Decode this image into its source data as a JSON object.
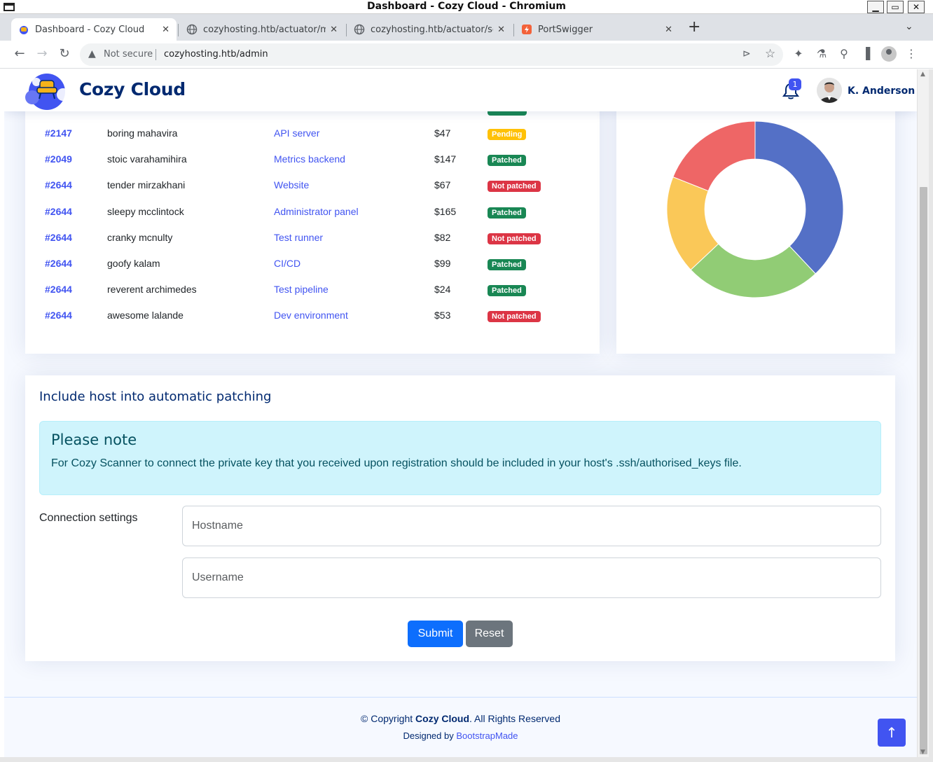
{
  "window": {
    "title": "Dashboard - Cozy Cloud - Chromium"
  },
  "tabs": [
    {
      "label": "Dashboard - Cozy Cloud",
      "active": true
    },
    {
      "label": "cozyhosting.htb/actuator/m",
      "active": false
    },
    {
      "label": "cozyhosting.htb/actuator/se",
      "active": false
    },
    {
      "label": "PortSwigger",
      "active": false
    }
  ],
  "address_bar": {
    "security_label": "Not secure",
    "url": "cozyhosting.htb/admin"
  },
  "header": {
    "brand": "Cozy Cloud",
    "notification_count": "1",
    "user_name": "K. Anderson"
  },
  "table": {
    "rows": [
      {
        "id": "#2147",
        "name": "boring mahavira",
        "service": "API server",
        "price": "$47",
        "status": "Pending",
        "status_type": "pending"
      },
      {
        "id": "#2049",
        "name": "stoic varahamihira",
        "service": "Metrics backend",
        "price": "$147",
        "status": "Patched",
        "status_type": "patched"
      },
      {
        "id": "#2644",
        "name": "tender mirzakhani",
        "service": "Website",
        "price": "$67",
        "status": "Not patched",
        "status_type": "notpatched"
      },
      {
        "id": "#2644",
        "name": "sleepy mcclintock",
        "service": "Administrator panel",
        "price": "$165",
        "status": "Patched",
        "status_type": "patched"
      },
      {
        "id": "#2644",
        "name": "cranky mcnulty",
        "service": "Test runner",
        "price": "$82",
        "status": "Not patched",
        "status_type": "notpatched"
      },
      {
        "id": "#2644",
        "name": "goofy kalam",
        "service": "CI/CD",
        "price": "$99",
        "status": "Patched",
        "status_type": "patched"
      },
      {
        "id": "#2644",
        "name": "reverent archimedes",
        "service": "Test pipeline",
        "price": "$24",
        "status": "Patched",
        "status_type": "patched"
      },
      {
        "id": "#2644",
        "name": "awesome lalande",
        "service": "Dev environment",
        "price": "$53",
        "status": "Not patched",
        "status_type": "notpatched"
      }
    ],
    "colors": {
      "patched": "#198754",
      "notpatched": "#dc3545",
      "pending": "#ffc107"
    }
  },
  "chart_data": {
    "type": "pie",
    "values": [
      38,
      25,
      18,
      19
    ],
    "colors": [
      "#5470c6",
      "#91cc75",
      "#fac858",
      "#ee6666"
    ],
    "inner_radius_ratio": 0.57
  },
  "form": {
    "title": "Include host into automatic patching",
    "note_title": "Please note",
    "note_text": "For Cozy Scanner to connect the private key that you received upon registration should be included in your host's .ssh/authorised_keys file.",
    "connection_label": "Connection settings",
    "hostname_placeholder": "Hostname",
    "username_placeholder": "Username",
    "submit_label": "Submit",
    "reset_label": "Reset"
  },
  "footer": {
    "copyright_prefix": "© Copyright ",
    "copyright_brand": "Cozy Cloud",
    "copyright_suffix": ". All Rights Reserved",
    "designed_by": "Designed by ",
    "designer": "BootstrapMade"
  },
  "icons": {
    "back": "←",
    "forward": "→",
    "reload": "↻",
    "warning": "▲",
    "send": "⊳",
    "star": "☆",
    "extensions": "✦",
    "labs": "⚗",
    "search": "⚲",
    "sidepanel": "▐",
    "menu": "⋮",
    "new_tab": "+",
    "tab_list": "⌄",
    "close": "✕",
    "back_to_top": "↑"
  }
}
